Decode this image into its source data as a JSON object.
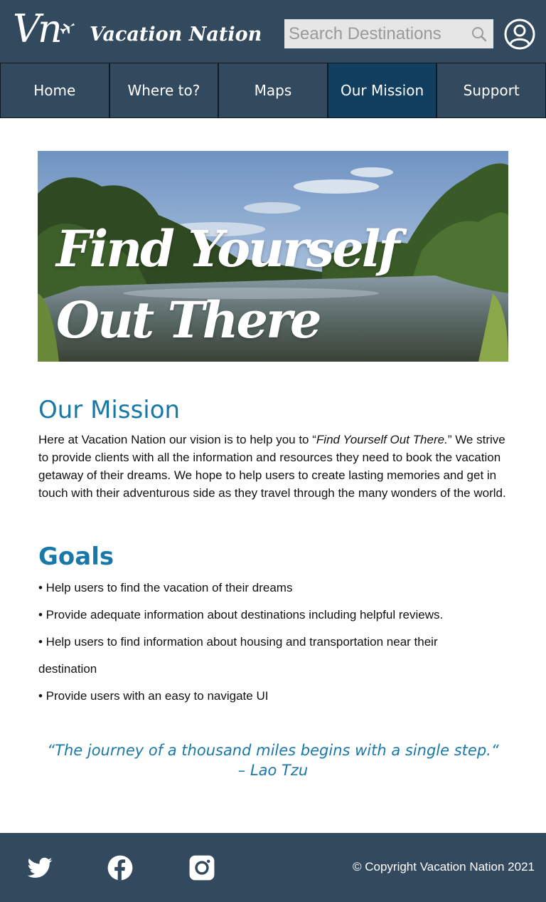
{
  "header": {
    "logo_mark": "Vn",
    "brand_name": "Vacation Nation",
    "search_placeholder": "Search Destinations"
  },
  "nav": {
    "items": [
      {
        "label": "Home"
      },
      {
        "label": "Where to?"
      },
      {
        "label": "Maps"
      },
      {
        "label": "Our Mission",
        "active": true
      },
      {
        "label": "Support"
      }
    ]
  },
  "hero": {
    "line1": "Find Yourself",
    "line2": "Out There"
  },
  "mission": {
    "heading": "Our Mission",
    "text_before": "Here at Vacation Nation our vision is to help you to “",
    "text_emphasis": "Find Yourself Out There.",
    "text_after": "” We strive to provide clients with all the information and resources they need to book the vacation getaway of their dreams. We hope to help users to create lasting memories and get in touch with their adventurous side as they travel through the many wonders of the world."
  },
  "goals": {
    "heading": "Goals",
    "items": [
      "• Help users to find the vacation of their dreams",
      "• Provide adequate information about destinations including helpful reviews.",
      "• Help users to find information about housing and transportation near their",
      "destination",
      "• Provide users with an easy to navigate UI"
    ]
  },
  "quote": {
    "text": "“The journey of a thousand miles begins with a single step.“",
    "author": "– Lao Tzu"
  },
  "footer": {
    "copyright": "© Copyright Vacation Nation 2021"
  },
  "colors": {
    "header_bg": "#33495e",
    "nav_active_bg": "#123e60",
    "accent": "#1a78a8"
  },
  "icons": [
    "airplane-icon",
    "search-icon",
    "user-account-icon",
    "twitter-icon",
    "facebook-icon",
    "instagram-icon"
  ]
}
